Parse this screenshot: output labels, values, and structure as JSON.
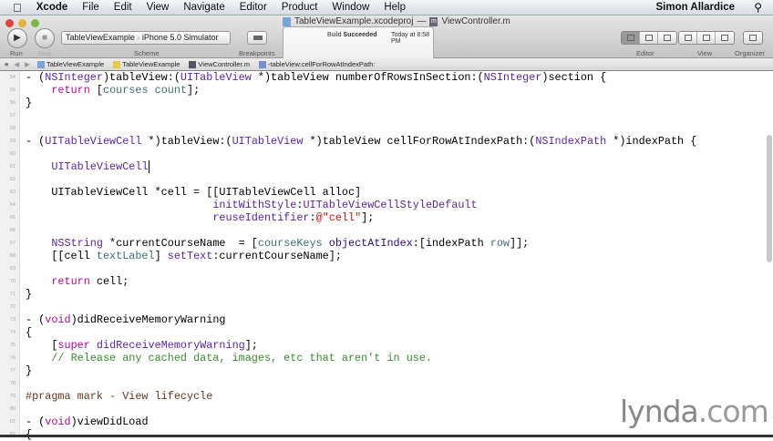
{
  "menubar": {
    "app": "Xcode",
    "items": [
      "File",
      "Edit",
      "View",
      "Navigate",
      "Editor",
      "Product",
      "Window",
      "Help"
    ],
    "user": "Simon Allardice"
  },
  "window": {
    "project_file": "TableViewExample.xcodeproj",
    "separator": "—",
    "file": "ViewController.m"
  },
  "toolbar": {
    "run": "Run",
    "stop": "Stop",
    "scheme_target": "TableViewExample",
    "scheme_device": "iPhone 5.0 Simulator",
    "scheme_label": "Scheme",
    "breakpoints": "Breakpoints",
    "editor": "Editor",
    "view": "View",
    "organizer": "Organizer"
  },
  "status": {
    "prefix": "Build",
    "result": "Succeeded",
    "time": "Today at 8:58 PM"
  },
  "jumpbar": [
    "TableViewExample",
    "TableViewExample",
    "ViewController.m",
    "-tableView:cellForRowAtIndexPath:"
  ],
  "colors": {
    "keyword": "#aa0d91",
    "class": "#5c2699",
    "project": "#3f6e74",
    "string": "#c41a16",
    "comment": "#3b8a34"
  },
  "code": [
    {
      "n": "54",
      "s": [
        [
          "",
          "- ("
        ],
        [
          "cls",
          "NSInteger"
        ],
        [
          "",
          ")tableView:("
        ],
        [
          "cls",
          "UITableView"
        ],
        [
          "",
          " *)tableView numberOfRowsInSection:("
        ],
        [
          "cls",
          "NSInteger"
        ],
        [
          "",
          ")section {"
        ]
      ]
    },
    {
      "n": "55",
      "s": [
        [
          "",
          "    "
        ],
        [
          "kw",
          "return"
        ],
        [
          "",
          " ["
        ],
        [
          "pid",
          "courses"
        ],
        [
          "",
          " "
        ],
        [
          "pid",
          "count"
        ],
        [
          "",
          "];"
        ]
      ]
    },
    {
      "n": "56",
      "s": [
        [
          "",
          "}"
        ]
      ]
    },
    {
      "n": "57",
      "s": []
    },
    {
      "n": "58",
      "s": []
    },
    {
      "n": "59",
      "s": [
        [
          "",
          "- ("
        ],
        [
          "cls",
          "UITableViewCell"
        ],
        [
          "",
          " *)tableView:("
        ],
        [
          "cls",
          "UITableView"
        ],
        [
          "",
          " *)tableView cellForRowAtIndexPath:("
        ],
        [
          "cls",
          "NSIndexPath"
        ],
        [
          "",
          " *)indexPath {"
        ]
      ]
    },
    {
      "n": "60",
      "s": []
    },
    {
      "n": "61",
      "s": [
        [
          "",
          "    "
        ],
        [
          "cls",
          "UITableViewCell"
        ],
        [
          "caret",
          ""
        ]
      ]
    },
    {
      "n": "62",
      "s": []
    },
    {
      "n": "63",
      "s": [
        [
          "",
          "    UITableViewCell *cell = [[UITableViewCell alloc]"
        ]
      ]
    },
    {
      "n": "64",
      "s": [
        [
          "",
          "                             "
        ],
        [
          "cls",
          "initWithStyle"
        ],
        [
          "",
          ":"
        ],
        [
          "cls",
          "UITableViewCellStyleDefault"
        ]
      ]
    },
    {
      "n": "65",
      "s": [
        [
          "",
          "                             "
        ],
        [
          "cls",
          "reuseIdentifier"
        ],
        [
          "",
          ":"
        ],
        [
          "str",
          "@\"cell\""
        ],
        [
          "",
          "];"
        ]
      ]
    },
    {
      "n": "66",
      "s": []
    },
    {
      "n": "67",
      "s": [
        [
          "",
          "    "
        ],
        [
          "cls",
          "NSString"
        ],
        [
          "",
          " *currentCourseName  = ["
        ],
        [
          "pid",
          "courseKeys"
        ],
        [
          "",
          " "
        ],
        [
          "sys",
          "objectAtIndex"
        ],
        [
          "",
          ":[indexPath "
        ],
        [
          "pid",
          "row"
        ],
        [
          "",
          "]];"
        ]
      ]
    },
    {
      "n": "68",
      "s": [
        [
          "",
          "    [[cell "
        ],
        [
          "pid",
          "textLabel"
        ],
        [
          "",
          "] "
        ],
        [
          "cls",
          "setText"
        ],
        [
          "",
          ":currentCourseName];"
        ]
      ]
    },
    {
      "n": "69",
      "s": []
    },
    {
      "n": "70",
      "s": [
        [
          "",
          "    "
        ],
        [
          "kw",
          "return"
        ],
        [
          "",
          " cell;"
        ]
      ]
    },
    {
      "n": "71",
      "s": [
        [
          "",
          "}"
        ]
      ]
    },
    {
      "n": "72",
      "s": []
    },
    {
      "n": "73",
      "s": [
        [
          "",
          "- ("
        ],
        [
          "kw",
          "void"
        ],
        [
          "",
          ")didReceiveMemoryWarning"
        ]
      ]
    },
    {
      "n": "74",
      "s": [
        [
          "",
          "{"
        ]
      ]
    },
    {
      "n": "75",
      "s": [
        [
          "",
          "    ["
        ],
        [
          "kw",
          "super"
        ],
        [
          "",
          " "
        ],
        [
          "cls",
          "didReceiveMemoryWarning"
        ],
        [
          "",
          "];"
        ]
      ]
    },
    {
      "n": "76",
      "s": [
        [
          "",
          "    "
        ],
        [
          "cm",
          "// Release any cached data, images, etc that aren't in use."
        ]
      ]
    },
    {
      "n": "77",
      "s": [
        [
          "",
          "}"
        ]
      ]
    },
    {
      "n": "78",
      "s": []
    },
    {
      "n": "79",
      "s": [
        [
          "pp",
          "#pragma mark - View lifecycle"
        ]
      ]
    },
    {
      "n": "80",
      "s": []
    },
    {
      "n": "81",
      "s": [
        [
          "",
          "- ("
        ],
        [
          "kw",
          "void"
        ],
        [
          "",
          ")viewDidLoad"
        ]
      ]
    },
    {
      "n": "82",
      "s": [
        [
          "",
          "{"
        ]
      ]
    }
  ],
  "watermark": {
    "brand": "lynda",
    ".com": ".com"
  }
}
